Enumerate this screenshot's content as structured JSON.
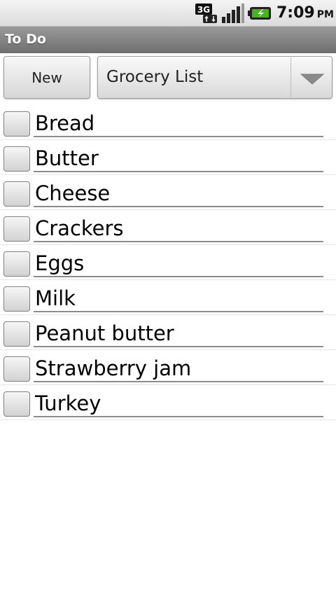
{
  "status_bar": {
    "network_icon": "3g-network-icon",
    "signal_icon": "signal-strength-icon",
    "battery_icon": "battery-charging-icon",
    "network_label": "3G",
    "time": "7:09",
    "ampm": "PM"
  },
  "app": {
    "title": "To Do"
  },
  "toolbar": {
    "new_label": "New",
    "list_selected": "Grocery List",
    "dropdown_icon": "dropdown-arrow-icon"
  },
  "items": [
    {
      "text": "Bread",
      "checked": false
    },
    {
      "text": "Butter",
      "checked": false
    },
    {
      "text": "Cheese",
      "checked": false
    },
    {
      "text": "Crackers",
      "checked": false
    },
    {
      "text": "Eggs",
      "checked": false
    },
    {
      "text": "Milk",
      "checked": false
    },
    {
      "text": "Peanut butter",
      "checked": false
    },
    {
      "text": "Strawberry jam",
      "checked": false
    },
    {
      "text": "Turkey",
      "checked": false
    }
  ]
}
